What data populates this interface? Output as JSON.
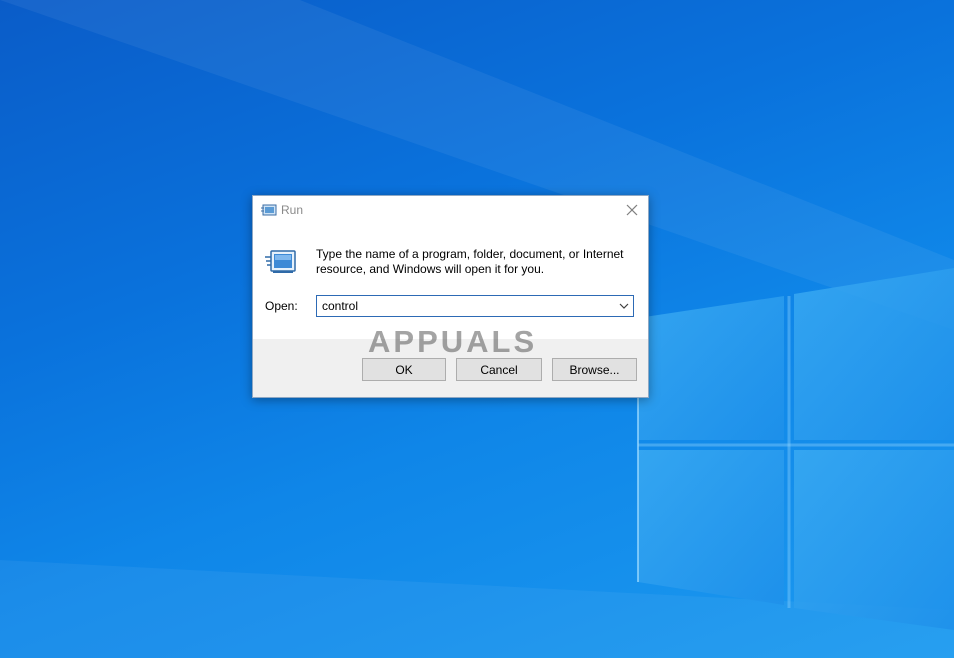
{
  "dialog": {
    "title": "Run",
    "description": "Type the name of a program, folder, document, or Internet resource, and Windows will open it for you.",
    "open_label": "Open:",
    "input_value": "control",
    "buttons": {
      "ok": "OK",
      "cancel": "Cancel",
      "browse": "Browse..."
    }
  },
  "watermark": {
    "text": "APPUALS"
  },
  "icons": {
    "title_icon": "run-icon",
    "big_icon": "run-icon",
    "close": "close-icon",
    "dropdown": "chevron-down-icon"
  },
  "colors": {
    "desktop_blue": "#0a72dc",
    "input_border": "#2d6ab5",
    "button_face": "#e1e1e1",
    "button_area": "#f0f0f0"
  }
}
